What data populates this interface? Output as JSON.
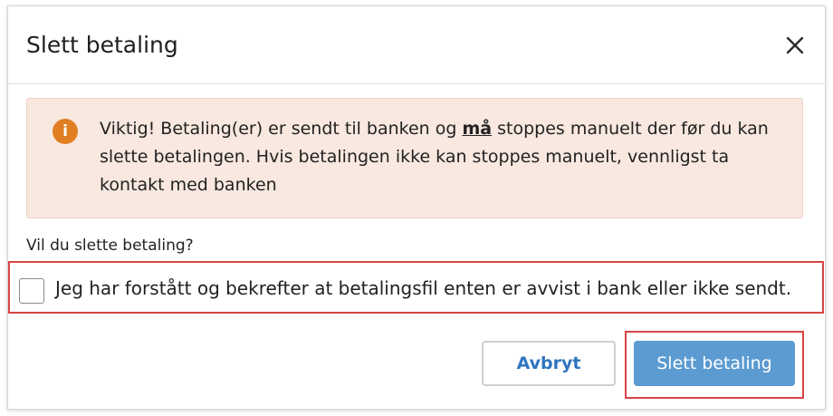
{
  "dialog": {
    "title": "Slett betaling",
    "close_icon": "close-icon"
  },
  "alert": {
    "icon": "info-icon",
    "icon_glyph": "i",
    "text_before": "Viktig! Betaling(er) er sendt til banken og ",
    "text_emphasis": "må",
    "text_after": " stoppes manuelt der før du kan slette betalingen. Hvis betalingen ikke kan stoppes manuelt, vennligst ta kontakt med banken",
    "background_color": "#f8e8df",
    "icon_color": "#e07e22"
  },
  "question": "Vil du slette betaling?",
  "confirm": {
    "label": "Jeg har forstått og bekrefter at betalingsfil enten er avvist i bank eller ikke sendt.",
    "checked": false
  },
  "buttons": {
    "cancel_label": "Avbryt",
    "delete_label": "Slett betaling",
    "primary_color": "#5b9bd1",
    "highlight_color": "#d94444"
  }
}
